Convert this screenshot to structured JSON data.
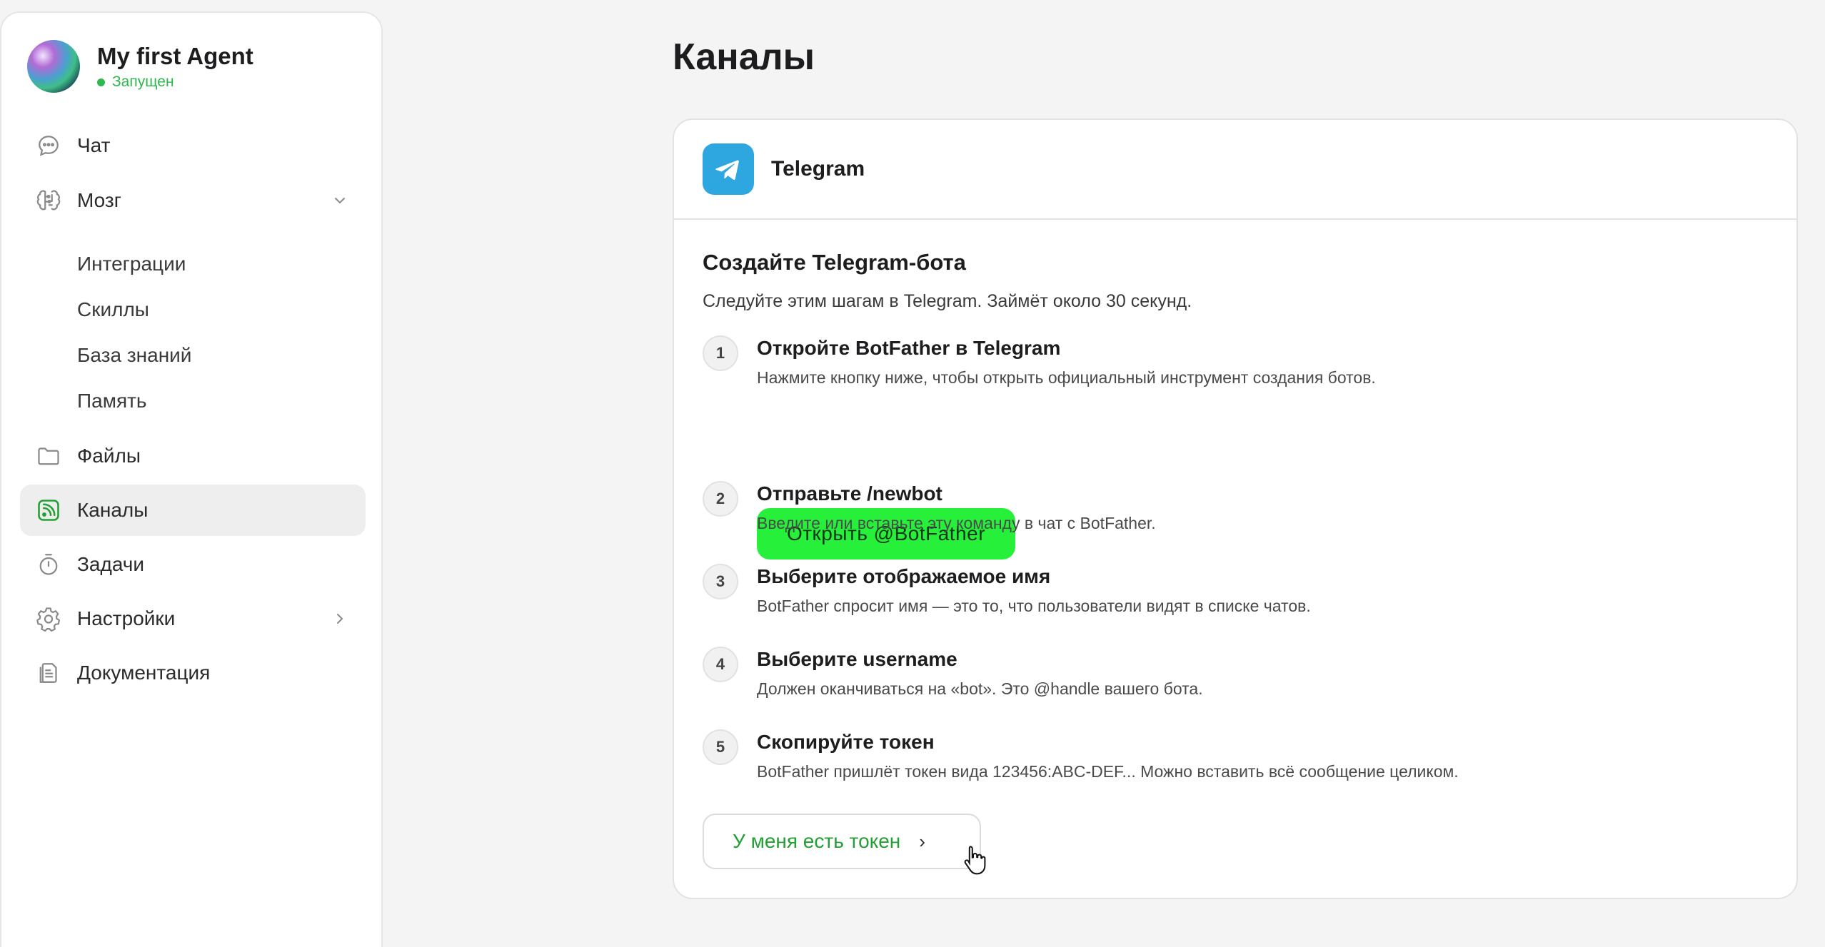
{
  "agent": {
    "name": "My first Agent",
    "status": "Запущен"
  },
  "sidebar": {
    "items": [
      {
        "label": "Чат",
        "icon": "chat-bubble-icon"
      },
      {
        "label": "Мозг",
        "icon": "brain-icon"
      },
      {
        "label": "Файлы",
        "icon": "folder-icon"
      },
      {
        "label": "Каналы",
        "icon": "rss-icon"
      },
      {
        "label": "Задачи",
        "icon": "stopwatch-icon"
      },
      {
        "label": "Настройки",
        "icon": "gear-icon"
      },
      {
        "label": "Документация",
        "icon": "document-icon"
      }
    ],
    "brain_subitems": [
      "Интеграции",
      "Скиллы",
      "База знаний",
      "Память"
    ]
  },
  "page": {
    "title": "Каналы"
  },
  "channel": {
    "name": "Telegram",
    "heading": "Создайте Telegram-бота",
    "lead": "Следуйте этим шагам в Telegram. Займёт около 30 секунд.",
    "steps": [
      {
        "num": "1",
        "title": "Откройте BotFather в Telegram",
        "desc": "Нажмите кнопку ниже, чтобы открыть официальный инструмент создания ботов."
      },
      {
        "num": "2",
        "title": "Отправьте /newbot",
        "desc": "Введите или вставьте эту команду в чат с BotFather."
      },
      {
        "num": "3",
        "title": "Выберите отображаемое имя",
        "desc": "BotFather спросит имя — это то, что пользователи видят в списке чатов."
      },
      {
        "num": "4",
        "title": "Выберите username",
        "desc": "Должен оканчиваться на «bot». Это @handle вашего бота."
      },
      {
        "num": "5",
        "title": "Скопируйте токен",
        "desc": "BotFather пришлёт токен вида 123456:ABC-DEF... Можно вставить всё сообщение целиком."
      }
    ],
    "open_botfather_label": "Открыть @BotFather",
    "have_token_label": "У меня есть токен",
    "have_token_arrow": "›"
  },
  "colors": {
    "accent_green": "#27f03b",
    "status_green": "#2db84d",
    "telegram_blue": "#2ea6e0"
  }
}
